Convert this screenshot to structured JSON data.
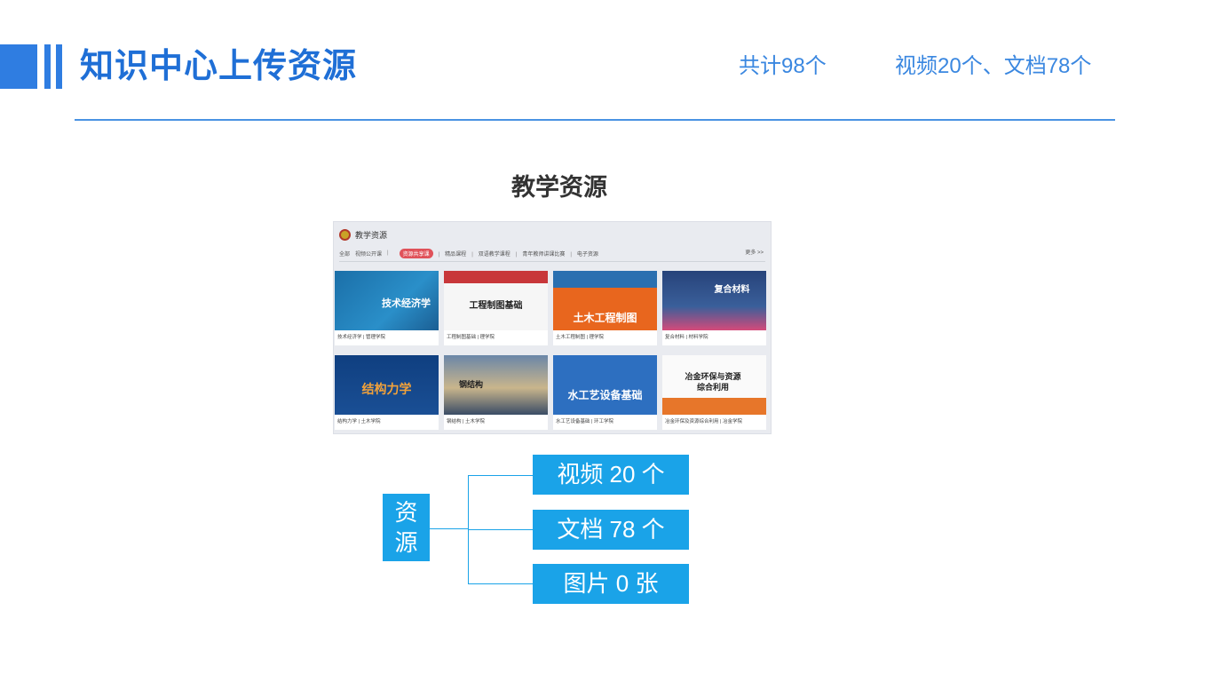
{
  "header": {
    "title": "知识中心上传资源",
    "total": "共计98个",
    "breakdown": "视频20个、文档78个"
  },
  "section_title": "教学资源",
  "screenshot": {
    "title": "教学资源",
    "tabs": [
      "全部",
      "视频公开课",
      "资源共享课",
      "精品课程",
      "双语教学课程",
      "青年教师讲课比赛",
      "电子资源"
    ],
    "active_tab": "资源共享课",
    "more": "更多 >>",
    "cards": [
      {
        "thumb": "技术经济学",
        "caption": "技术经济学 | 管理学院"
      },
      {
        "thumb": "工程制图基础",
        "caption": "工程制图基础 | 理学院"
      },
      {
        "thumb": "土木工程制图",
        "caption": "土木工程制图 | 理学院"
      },
      {
        "thumb": "复合材料",
        "caption": "复合材料 | 材料学院"
      },
      {
        "thumb": "结构力学",
        "caption": "结构力学 | 土木学院"
      },
      {
        "thumb": "钢结构",
        "caption": "钢结构 | 土木学院"
      },
      {
        "thumb": "水工艺设备基础",
        "caption": "水工艺设备基础 | 环工学院"
      },
      {
        "thumb": "冶金环保与资源综合利用",
        "caption": "冶金环保及资源综合利用 | 冶金学院"
      }
    ]
  },
  "tree": {
    "root": "资源",
    "leaves": [
      "视频  20 个",
      "文档  78 个",
      "图片 0  张"
    ]
  },
  "colors": {
    "accent": "#2f7de1",
    "diagram": "#1aa3e8"
  }
}
